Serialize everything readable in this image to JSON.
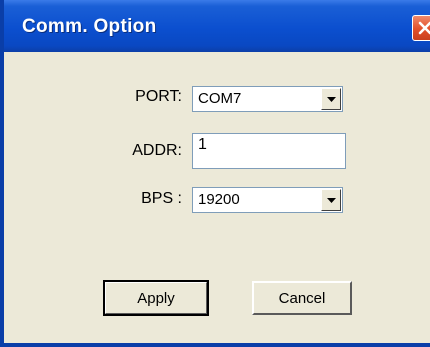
{
  "window": {
    "title": "Comm. Option"
  },
  "form": {
    "port": {
      "label": "PORT:",
      "value": "COM7"
    },
    "addr": {
      "label": "ADDR:",
      "value": "1"
    },
    "bps": {
      "label": "BPS :",
      "value": "19200"
    }
  },
  "buttons": {
    "apply": "Apply",
    "cancel": "Cancel"
  },
  "icons": {
    "close": "close-icon",
    "dropdown": "chevron-down-icon"
  }
}
